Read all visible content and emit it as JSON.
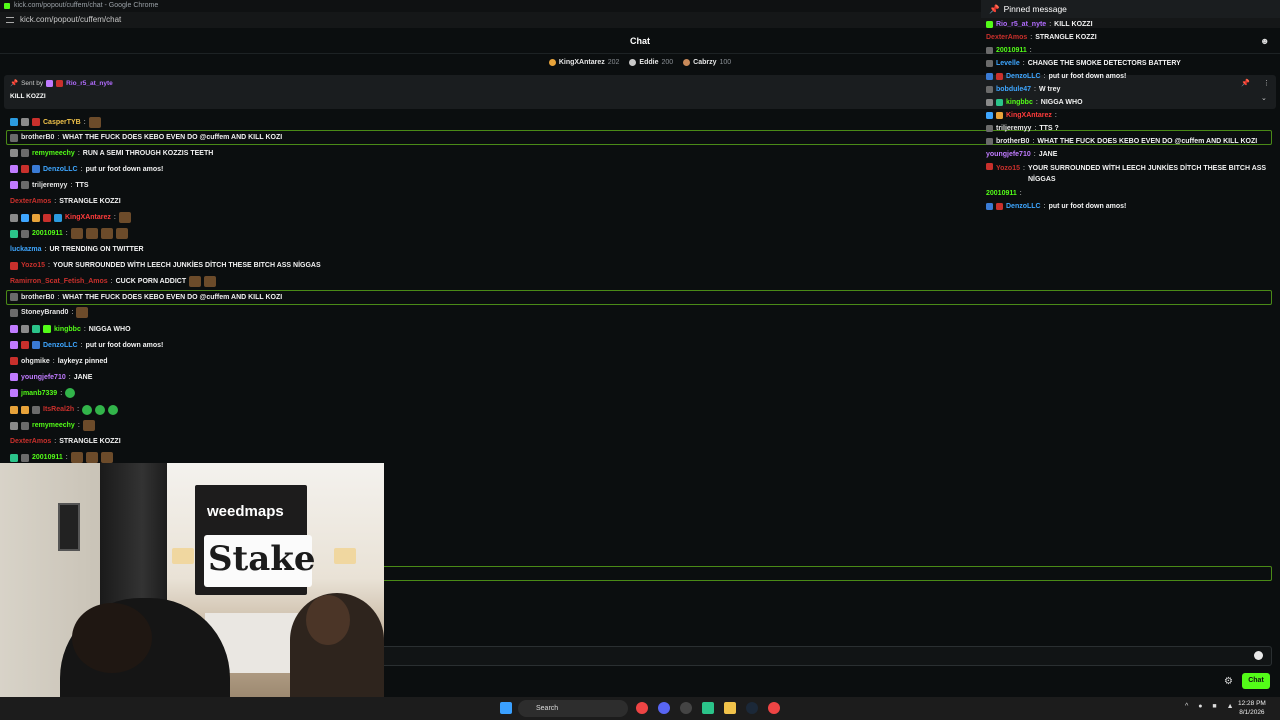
{
  "browser": {
    "window_title": "kick.com/popout/cuffem/chat - Google Chrome",
    "url": "kick.com/popout/cuffem/chat"
  },
  "header": {
    "title": "Chat"
  },
  "leaderboard": [
    {
      "name": "KingXAntarez",
      "points": "202",
      "color": "#e8a33a"
    },
    {
      "name": "Eddie",
      "points": "200",
      "color": "#c9c9c9"
    },
    {
      "name": "Cabrzy",
      "points": "100",
      "color": "#c98a5a"
    }
  ],
  "pinned": {
    "sent_by_label": "Sent by",
    "sender": "Rio_r5_at_nyte",
    "message": "KILL KOZZI"
  },
  "messages": [
    {
      "user": "CasperTYB",
      "color": "#f0c24a",
      "text": "",
      "badges": [
        "#2b9be0",
        "#8a8a8a",
        "#c9302c"
      ],
      "emotes": 1,
      "highlight": false
    },
    {
      "user": "brotherB0",
      "color": "#e6e6e6",
      "text": "WHAT THE FUCK DOES KEBO EVEN DO @cuffem AND KILL KOZI",
      "badges": [
        "#6b6b6b"
      ],
      "emotes": 0,
      "highlight": true
    },
    {
      "user": "remymeechy",
      "color": "#53fc18",
      "text": "RUN A SEMI THROUGH KOZZIS TEETH",
      "badges": [
        "#8a8a8a",
        "#6b6b6b"
      ],
      "emotes": 0,
      "highlight": false
    },
    {
      "user": "DenzoLLC",
      "color": "#3ea6ff",
      "text": "put ur foot down amos!",
      "badges": [
        "#c07bff",
        "#c9302c",
        "#3a7bd5"
      ],
      "emotes": 0,
      "highlight": false
    },
    {
      "user": "triljeremyy",
      "color": "#e6e6e6",
      "text": "TTS",
      "badges": [
        "#c07bff",
        "#6b6b6b"
      ],
      "emotes": 0,
      "highlight": false
    },
    {
      "user": "DexterAmos",
      "color": "#c9302c",
      "text": "STRANGLE KOZZI",
      "badges": [],
      "emotes": 0,
      "highlight": false
    },
    {
      "user": "KingXAntarez",
      "color": "#ff3b3b",
      "text": "",
      "badges": [
        "#8a8a8a",
        "#3ea6ff",
        "#e8a33a",
        "#c9302c",
        "#2b9be0"
      ],
      "emotes": 1,
      "highlight": false
    },
    {
      "user": "20010911",
      "color": "#53fc18",
      "text": "",
      "badges": [
        "#2bc48a",
        "#6b6b6b"
      ],
      "emotes": 4,
      "highlight": false
    },
    {
      "user": "luckazma",
      "color": "#3ea6ff",
      "text": "UR TRENDING ON TWITTER",
      "badges": [],
      "emotes": 0,
      "highlight": false
    },
    {
      "user": "Yozo15",
      "color": "#c9302c",
      "text": "YOUR SURROUNDED WİTH LEECH JUNKİES DİTCH THESE BITCH ASS NİGGAS",
      "badges": [
        "#c9302c"
      ],
      "emotes": 0,
      "highlight": false
    },
    {
      "user": "Ramirron_Scat_Fetish_Amos",
      "color": "#c9302c",
      "text": "CUCK PORN ADDICT",
      "badges": [],
      "emotes": 2,
      "highlight": false
    },
    {
      "user": "brotherB0",
      "color": "#e6e6e6",
      "text": "WHAT THE FUCK DOES KEBO EVEN DO @cuffem AND KILL KOZI",
      "badges": [
        "#6b6b6b"
      ],
      "emotes": 0,
      "highlight": true
    },
    {
      "user": "StoneyBrand0",
      "color": "#e6e6e6",
      "text": "",
      "badges": [
        "#6b6b6b"
      ],
      "emotes": 1,
      "highlight": false
    },
    {
      "user": "kingbbc",
      "color": "#53fc18",
      "text": "NIGGA WHO",
      "badges": [
        "#c07bff",
        "#8a8a8a",
        "#2bc48a",
        "#53fc18"
      ],
      "emotes": 0,
      "highlight": false
    },
    {
      "user": "DenzoLLC",
      "color": "#3ea6ff",
      "text": "put ur foot down amos!",
      "badges": [
        "#c07bff",
        "#c9302c",
        "#3a7bd5"
      ],
      "emotes": 0,
      "highlight": false
    },
    {
      "user": "ohgmike",
      "color": "#e6e6e6",
      "text": "laykeyz pinned",
      "badges": [
        "#c9302c"
      ],
      "emotes": 0,
      "highlight": false
    },
    {
      "user": "youngjefe710",
      "color": "#c07bff",
      "text": "JANE",
      "badges": [
        "#c07bff"
      ],
      "emotes": 0,
      "highlight": false
    },
    {
      "user": "jmanb7339",
      "color": "#53fc18",
      "text": "",
      "badges": [
        "#c07bff"
      ],
      "emotes": 1,
      "highlight": false
    },
    {
      "user": "ItsReal2h",
      "color": "#c9302c",
      "text": "",
      "badges": [
        "#e8a33a",
        "#e8a33a",
        "#6b6b6b"
      ],
      "emotes": 3,
      "highlight": false
    },
    {
      "user": "remymeechy",
      "color": "#53fc18",
      "text": "",
      "badges": [
        "#8a8a8a",
        "#6b6b6b"
      ],
      "emotes": 1,
      "highlight": false
    },
    {
      "user": "DexterAmos",
      "color": "#c9302c",
      "text": "STRANGLE KOZZI",
      "badges": [],
      "emotes": 0,
      "highlight": false
    },
    {
      "user": "20010911",
      "color": "#53fc18",
      "text": "",
      "badges": [
        "#2bc48a",
        "#6b6b6b"
      ],
      "emotes": 3,
      "highlight": false
    }
  ],
  "overlay": {
    "pinned_title": "Pinned message",
    "rows": [
      {
        "user": "Rio_r5_at_nyte",
        "color": "#b26cff",
        "text": "KILL KOZZI",
        "badges": [
          "#53fc18"
        ]
      },
      {
        "user": "DexterAmos",
        "color": "#c9302c",
        "text": "STRANGLE KOZZI",
        "badges": []
      },
      {
        "user": "20010911",
        "color": "#53fc18",
        "text": "",
        "badges": [
          "#6b6b6b"
        ]
      },
      {
        "user": "Levelle",
        "color": "#3ea6ff",
        "text": "CHANGE THE SMOKE DETECTORS BATTERY",
        "badges": [
          "#6b6b6b"
        ]
      },
      {
        "user": "DenzoLLC",
        "color": "#3ea6ff",
        "text": "put ur foot down amos!",
        "badges": [
          "#3a7bd5",
          "#c9302c"
        ]
      },
      {
        "user": "bobdule47",
        "color": "#3ea6ff",
        "text": "W trey",
        "badges": [
          "#6b6b6b"
        ]
      },
      {
        "user": "kingbbc",
        "color": "#53fc18",
        "text": "NIGGA WHO",
        "badges": [
          "#8a8a8a",
          "#2bc48a"
        ]
      },
      {
        "user": "KingXAntarez",
        "color": "#ff3b3b",
        "text": "",
        "badges": [
          "#3ea6ff",
          "#e8a33a"
        ]
      },
      {
        "user": "triljeremyy",
        "color": "#e6e6e6",
        "text": "TTS ?",
        "badges": [
          "#6b6b6b"
        ]
      },
      {
        "user": "brotherB0",
        "color": "#e6e6e6",
        "text": "WHAT THE FUCK DOES KEBO EVEN DO @cuffem AND KILL KOZI",
        "badges": [
          "#6b6b6b"
        ]
      },
      {
        "user": "youngjefe710",
        "color": "#c07bff",
        "text": "JANE",
        "badges": []
      },
      {
        "user": "Yozo15",
        "color": "#c9302c",
        "text": "YOUR SURROUNDED WİTH LEECH JUNKİES DİTCH THESE BITCH ASS NİGGAS",
        "badges": [
          "#c9302c"
        ],
        "two": true
      },
      {
        "user": "20010911",
        "color": "#53fc18",
        "text": "",
        "badges": []
      },
      {
        "user": "DenzoLLC",
        "color": "#3ea6ff",
        "text": "put ur foot down amos!",
        "badges": [
          "#3a7bd5",
          "#c9302c"
        ]
      }
    ]
  },
  "video": {
    "banner_brand": "weedmaps",
    "card_brand": "Stake"
  },
  "composer": {
    "send_label": "Chat"
  },
  "taskbar": {
    "search_label": "Search",
    "time": "12:28 PM",
    "date": "8/1/2026"
  }
}
